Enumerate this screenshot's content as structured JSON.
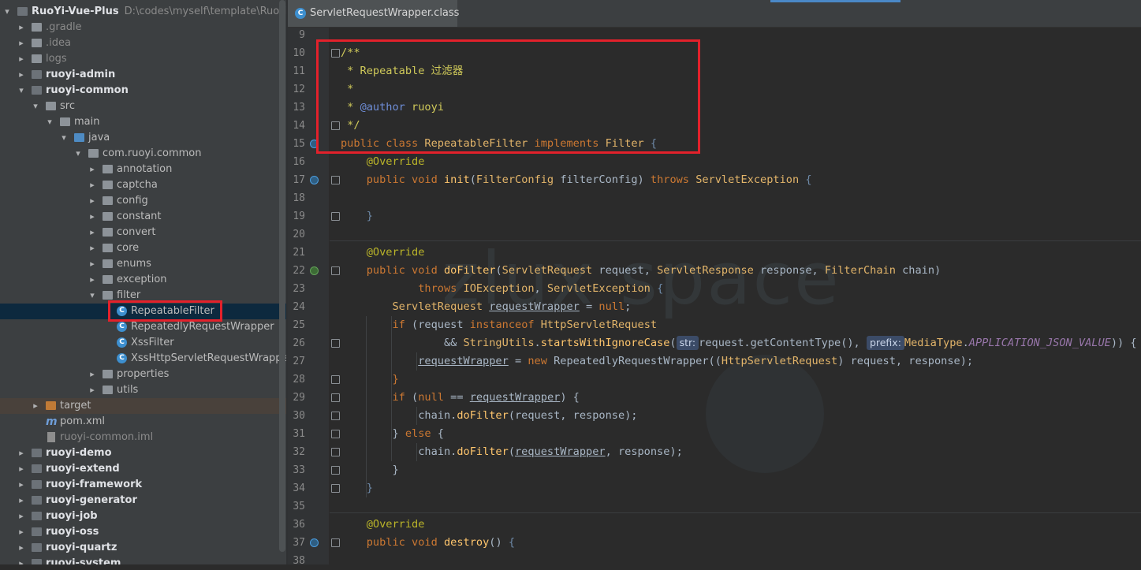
{
  "tree": {
    "rows": [
      {
        "label": "RuoYi-Vue-Plus",
        "path": "D:\\codes\\myself\\template\\RuoYi-V",
        "indent": 0,
        "arrow": "▾",
        "icon": "folder-dark",
        "bold": true
      },
      {
        "label": ".gradle",
        "indent": 1,
        "arrow": "▸",
        "icon": "folder",
        "dim": true
      },
      {
        "label": ".idea",
        "indent": 1,
        "arrow": "▸",
        "icon": "folder",
        "dim": true
      },
      {
        "label": "logs",
        "indent": 1,
        "arrow": "▸",
        "icon": "folder",
        "dim": true
      },
      {
        "label": "ruoyi-admin",
        "indent": 1,
        "arrow": "▸",
        "icon": "folder-dark",
        "bold": true
      },
      {
        "label": "ruoyi-common",
        "indent": 1,
        "arrow": "▾",
        "icon": "folder-dark",
        "bold": true
      },
      {
        "label": "src",
        "indent": 2,
        "arrow": "▾",
        "icon": "folder"
      },
      {
        "label": "main",
        "indent": 3,
        "arrow": "▾",
        "icon": "folder"
      },
      {
        "label": "java",
        "indent": 4,
        "arrow": "▾",
        "icon": "folder-blue"
      },
      {
        "label": "com.ruoyi.common",
        "indent": 5,
        "arrow": "▾",
        "icon": "folder"
      },
      {
        "label": "annotation",
        "indent": 6,
        "arrow": "▸",
        "icon": "folder"
      },
      {
        "label": "captcha",
        "indent": 6,
        "arrow": "▸",
        "icon": "folder"
      },
      {
        "label": "config",
        "indent": 6,
        "arrow": "▸",
        "icon": "folder"
      },
      {
        "label": "constant",
        "indent": 6,
        "arrow": "▸",
        "icon": "folder"
      },
      {
        "label": "convert",
        "indent": 6,
        "arrow": "▸",
        "icon": "folder"
      },
      {
        "label": "core",
        "indent": 6,
        "arrow": "▸",
        "icon": "folder"
      },
      {
        "label": "enums",
        "indent": 6,
        "arrow": "▸",
        "icon": "folder"
      },
      {
        "label": "exception",
        "indent": 6,
        "arrow": "▸",
        "icon": "folder"
      },
      {
        "label": "filter",
        "indent": 6,
        "arrow": "▾",
        "icon": "folder"
      },
      {
        "label": "RepeatableFilter",
        "indent": 7,
        "arrow": "",
        "icon": "class",
        "selected": true
      },
      {
        "label": "RepeatedlyRequestWrapper",
        "indent": 7,
        "arrow": "",
        "icon": "class"
      },
      {
        "label": "XssFilter",
        "indent": 7,
        "arrow": "",
        "icon": "class"
      },
      {
        "label": "XssHttpServletRequestWrapper",
        "indent": 7,
        "arrow": "",
        "icon": "class"
      },
      {
        "label": "properties",
        "indent": 6,
        "arrow": "▸",
        "icon": "folder"
      },
      {
        "label": "utils",
        "indent": 6,
        "arrow": "▸",
        "icon": "folder"
      },
      {
        "label": "target",
        "indent": 2,
        "arrow": "▸",
        "icon": "folder-orange",
        "target": true
      },
      {
        "label": "pom.xml",
        "indent": 2,
        "arrow": "",
        "icon": "maven"
      },
      {
        "label": "ruoyi-common.iml",
        "indent": 2,
        "arrow": "",
        "icon": "file",
        "dim": true
      },
      {
        "label": "ruoyi-demo",
        "indent": 1,
        "arrow": "▸",
        "icon": "folder-dark",
        "bold": true
      },
      {
        "label": "ruoyi-extend",
        "indent": 1,
        "arrow": "▸",
        "icon": "folder-dark",
        "bold": true
      },
      {
        "label": "ruoyi-framework",
        "indent": 1,
        "arrow": "▸",
        "icon": "folder-dark",
        "bold": true
      },
      {
        "label": "ruoyi-generator",
        "indent": 1,
        "arrow": "▸",
        "icon": "folder-dark",
        "bold": true
      },
      {
        "label": "ruoyi-job",
        "indent": 1,
        "arrow": "▸",
        "icon": "folder-dark",
        "bold": true
      },
      {
        "label": "ruoyi-oss",
        "indent": 1,
        "arrow": "▸",
        "icon": "folder-dark",
        "bold": true
      },
      {
        "label": "ruoyi-quartz",
        "indent": 1,
        "arrow": "▸",
        "icon": "folder-dark",
        "bold": true
      },
      {
        "label": "ruoyi-system",
        "indent": 1,
        "arrow": "▸",
        "icon": "folder-dark",
        "bold": true
      }
    ]
  },
  "editor": {
    "tab_label": "ServletRequestWrapper.class",
    "tab_icon": "C",
    "watermark": "zlux space",
    "line_numbers": [
      "9",
      "10",
      "11",
      "12",
      "13",
      "14",
      "15",
      "16",
      "17",
      "18",
      "19",
      "20",
      "21",
      "22",
      "23",
      "24",
      "25",
      "26",
      "27",
      "28",
      "29",
      "30",
      "31",
      "32",
      "33",
      "34",
      "35",
      "36",
      "37",
      "38"
    ],
    "lines": [
      [],
      [
        {
          "t": "/**",
          "c": "doc"
        }
      ],
      [
        {
          "t": " * Repeatable 过滤器",
          "c": "doc"
        }
      ],
      [
        {
          "t": " *",
          "c": "doc"
        }
      ],
      [
        {
          "t": " * ",
          "c": "doc"
        },
        {
          "t": "@author",
          "c": "doctag"
        },
        {
          "t": " ruoyi",
          "c": "doc"
        }
      ],
      [
        {
          "t": " */",
          "c": "doc"
        }
      ],
      [
        {
          "t": "public class ",
          "c": "kw"
        },
        {
          "t": "RepeatableFilter ",
          "c": "cls"
        },
        {
          "t": "implements ",
          "c": "kw"
        },
        {
          "t": "Filter ",
          "c": "cls"
        },
        {
          "t": "{",
          "c": "brace"
        }
      ],
      [
        {
          "t": "    "
        },
        {
          "t": "@Override",
          "c": "ann"
        }
      ],
      [
        {
          "t": "    "
        },
        {
          "t": "public void ",
          "c": "kw"
        },
        {
          "t": "init",
          "c": "fn"
        },
        {
          "t": "("
        },
        {
          "t": "FilterConfig ",
          "c": "cls"
        },
        {
          "t": "filterConfig) "
        },
        {
          "t": "throws ",
          "c": "kw"
        },
        {
          "t": "ServletException ",
          "c": "cls"
        },
        {
          "t": "{",
          "c": "brace"
        }
      ],
      [],
      [
        {
          "t": "    "
        },
        {
          "t": "}",
          "c": "brace"
        }
      ],
      [],
      [
        {
          "t": "    "
        },
        {
          "t": "@Override",
          "c": "ann"
        }
      ],
      [
        {
          "t": "    "
        },
        {
          "t": "public void ",
          "c": "kw"
        },
        {
          "t": "doFilter",
          "c": "fn"
        },
        {
          "t": "("
        },
        {
          "t": "ServletRequest ",
          "c": "cls"
        },
        {
          "t": "request, "
        },
        {
          "t": "ServletResponse ",
          "c": "cls"
        },
        {
          "t": "response, "
        },
        {
          "t": "FilterChain ",
          "c": "cls"
        },
        {
          "t": "chain)"
        }
      ],
      [
        {
          "t": "            "
        },
        {
          "t": "throws ",
          "c": "kw"
        },
        {
          "t": "IOException",
          "c": "cls"
        },
        {
          "t": ", "
        },
        {
          "t": "ServletException ",
          "c": "cls"
        },
        {
          "t": "{",
          "c": "brace"
        }
      ],
      [
        {
          "t": "        "
        },
        {
          "t": "ServletRequest ",
          "c": "cls"
        },
        {
          "t": "requestWrapper",
          "c": "ul"
        },
        {
          "t": " = "
        },
        {
          "t": "null",
          "c": "kw"
        },
        {
          "t": ";"
        }
      ],
      [
        {
          "t": "        "
        },
        {
          "t": "if ",
          "c": "kw"
        },
        {
          "t": "(request "
        },
        {
          "t": "instanceof ",
          "c": "kw"
        },
        {
          "t": "HttpServletRequest",
          "c": "cls"
        }
      ],
      [
        {
          "t": "                && "
        },
        {
          "t": "StringUtils",
          "c": "cls"
        },
        {
          "t": "."
        },
        {
          "t": "startsWithIgnoreCase",
          "c": "fn"
        },
        {
          "t": "("
        },
        {
          "t": "str:",
          "c": "hint"
        },
        {
          "t": "request.getContentType(), "
        },
        {
          "t": "prefix:",
          "c": "hint"
        },
        {
          "t": "MediaType",
          "c": "cls"
        },
        {
          "t": "."
        },
        {
          "t": "APPLICATION_JSON_VALUE",
          "c": "const"
        },
        {
          "t": ")) {"
        }
      ],
      [
        {
          "t": "            "
        },
        {
          "t": "requestWrapper",
          "c": "ul"
        },
        {
          "t": " = "
        },
        {
          "t": "new ",
          "c": "kw"
        },
        {
          "t": "RepeatedlyRequestWrapper",
          "c": "var"
        },
        {
          "t": "(("
        },
        {
          "t": "HttpServletRequest",
          "c": "cls"
        },
        {
          "t": ") request, response);"
        }
      ],
      [
        {
          "t": "        "
        },
        {
          "t": "}",
          "c": "kw"
        }
      ],
      [
        {
          "t": "        "
        },
        {
          "t": "if ",
          "c": "kw"
        },
        {
          "t": "("
        },
        {
          "t": "null",
          "c": "kw"
        },
        {
          "t": " == "
        },
        {
          "t": "requestWrapper",
          "c": "ul"
        },
        {
          "t": ") {"
        }
      ],
      [
        {
          "t": "            chain."
        },
        {
          "t": "doFilter",
          "c": "fn"
        },
        {
          "t": "(request, response);"
        }
      ],
      [
        {
          "t": "        } "
        },
        {
          "t": "else ",
          "c": "kw"
        },
        {
          "t": "{"
        }
      ],
      [
        {
          "t": "            chain."
        },
        {
          "t": "doFilter",
          "c": "fn"
        },
        {
          "t": "("
        },
        {
          "t": "requestWrapper",
          "c": "ul"
        },
        {
          "t": ", response);"
        }
      ],
      [
        {
          "t": "        }"
        }
      ],
      [
        {
          "t": "    "
        },
        {
          "t": "}",
          "c": "brace"
        }
      ],
      [],
      [
        {
          "t": "    "
        },
        {
          "t": "@Override",
          "c": "ann"
        }
      ],
      [
        {
          "t": "    "
        },
        {
          "t": "public void ",
          "c": "kw"
        },
        {
          "t": "destroy",
          "c": "fn"
        },
        {
          "t": "() "
        },
        {
          "t": "{",
          "c": "brace"
        }
      ],
      []
    ]
  },
  "colors": {
    "highlight_box": "#e3212b",
    "selection": "#0d293e"
  }
}
